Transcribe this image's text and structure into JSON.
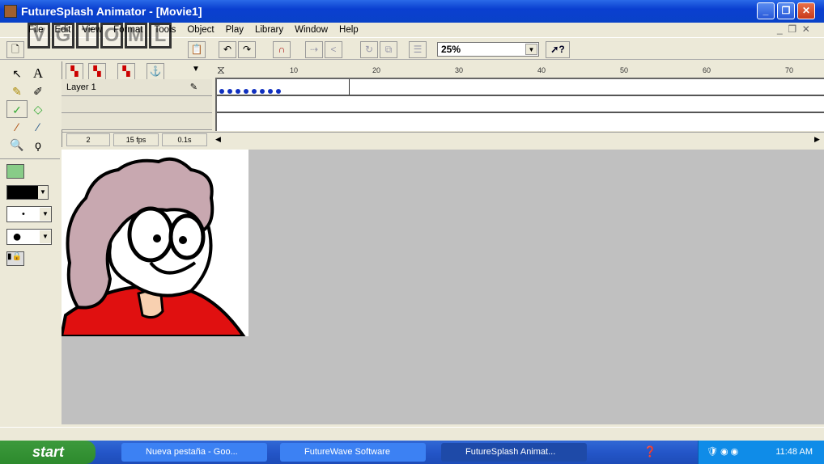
{
  "window": {
    "title": "FutureSplash Animator - [Movie1]"
  },
  "menu": [
    "File",
    "Edit",
    "View",
    "Format",
    "Tools",
    "Object",
    "Play",
    "Library",
    "Window",
    "Help"
  ],
  "watermark": "VGTOML",
  "toolbar": {
    "zoom": "25%",
    "help_label": "?"
  },
  "timeline": {
    "layers": [
      {
        "name": "Layer 1"
      }
    ],
    "ruler_ticks": [
      "10",
      "20",
      "30",
      "40",
      "50",
      "60",
      "70"
    ],
    "current_frame": "2",
    "fps": "15 fps",
    "time": "0.1s",
    "frame_count": 8
  },
  "taskbar": {
    "start": "start",
    "tasks": [
      "Nueva pestaña - Goo...",
      "FutureWave Software",
      "FutureSplash Animat..."
    ],
    "clock": "11:48 AM"
  },
  "colors": {
    "title": "#0a3fd0",
    "stage": "#c0c0c0",
    "shirt": "#e01010",
    "hair": "#c8a8b0",
    "keyframe": "#1030c0"
  }
}
